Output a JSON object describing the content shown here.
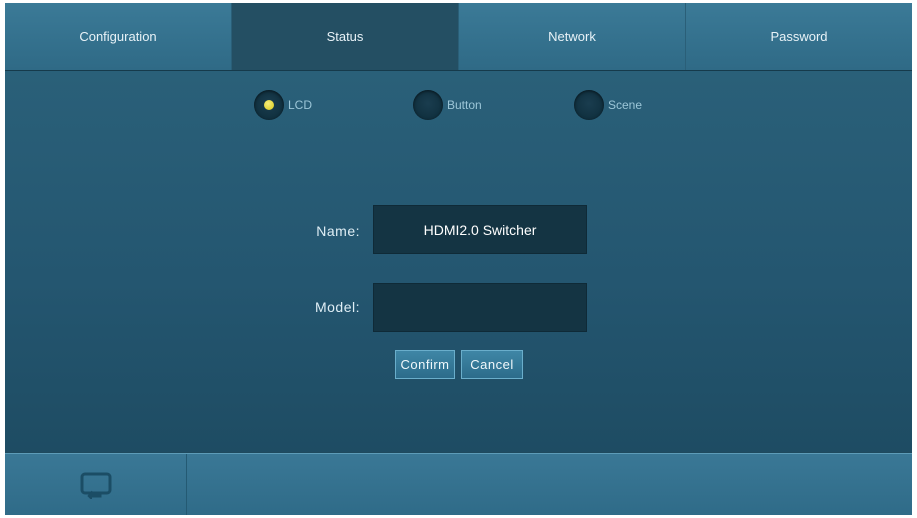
{
  "tabs": [
    {
      "label": "Configuration",
      "active": false
    },
    {
      "label": "Status",
      "active": true
    },
    {
      "label": "Network",
      "active": false
    },
    {
      "label": "Password",
      "active": false
    }
  ],
  "radios": {
    "lcd": {
      "label": "LCD",
      "selected": true
    },
    "button": {
      "label": "Button",
      "selected": false
    },
    "scene": {
      "label": "Scene",
      "selected": false
    }
  },
  "form": {
    "name_label": "Name:",
    "name_value": "HDMI2.0 Switcher",
    "model_label": "Model:",
    "model_value": ""
  },
  "buttons": {
    "confirm": "Confirm",
    "cancel": "Cancel"
  },
  "bottom": {
    "return_icon": "return-icon"
  },
  "colors": {
    "accent_dot": "#e3d52a",
    "background": "#1f4a5e"
  }
}
